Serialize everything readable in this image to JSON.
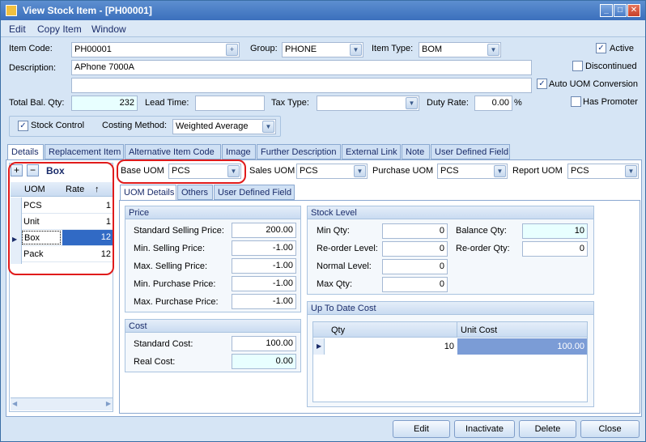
{
  "window": {
    "title": "View Stock Item - [PH00001]"
  },
  "menu": [
    "Edit",
    "Copy Item",
    "Window"
  ],
  "form": {
    "item_code_label": "Item Code:",
    "item_code": "PH00001",
    "group_label": "Group:",
    "group": "PHONE",
    "item_type_label": "Item Type:",
    "item_type": "BOM",
    "active_label": "Active",
    "discontinued_label": "Discontinued",
    "auto_uom_label": "Auto UOM Conversion",
    "has_promoter_label": "Has Promoter",
    "description_label": "Description:",
    "description": "APhone 7000A",
    "total_bal_label": "Total Bal. Qty:",
    "total_bal": "232",
    "lead_time_label": "Lead Time:",
    "tax_type_label": "Tax Type:",
    "duty_rate_label": "Duty Rate:",
    "duty_rate": "0.00",
    "percent": "%",
    "stock_control_label": "Stock Control",
    "costing_method_label": "Costing Method:",
    "costing_method": "Weighted Average"
  },
  "tabs": [
    "Details",
    "Replacement Item",
    "Alternative Item Code",
    "Image",
    "Further Description",
    "External Link",
    "Note",
    "User Defined Field"
  ],
  "uom_list": {
    "selected": "Box",
    "header": {
      "uom": "UOM",
      "rate": "Rate",
      "sort": "↑"
    },
    "rows": [
      {
        "uom": "PCS",
        "rate": "1"
      },
      {
        "uom": "Unit",
        "rate": "1"
      },
      {
        "uom": "Box",
        "rate": "12"
      },
      {
        "uom": "Pack",
        "rate": "12"
      }
    ]
  },
  "uom_bar": {
    "base_label": "Base UOM",
    "base": "PCS",
    "sales_label": "Sales UOM",
    "sales": "PCS",
    "purchase_label": "Purchase UOM",
    "purchase": "PCS",
    "report_label": "Report UOM",
    "report": "PCS"
  },
  "subtabs": [
    "UOM Details",
    "Others",
    "User Defined Field"
  ],
  "price": {
    "title": "Price",
    "std_sell_label": "Standard Selling Price:",
    "std_sell": "200.00",
    "min_sell_label": "Min. Selling Price:",
    "min_sell": "-1.00",
    "max_sell_label": "Max. Selling Price:",
    "max_sell": "-1.00",
    "min_pur_label": "Min. Purchase Price:",
    "min_pur": "-1.00",
    "max_pur_label": "Max. Purchase Price:",
    "max_pur": "-1.00"
  },
  "cost": {
    "title": "Cost",
    "std_cost_label": "Standard Cost:",
    "std_cost": "100.00",
    "real_cost_label": "Real Cost:",
    "real_cost": "0.00"
  },
  "stock_level": {
    "title": "Stock Level",
    "min_qty_label": "Min Qty:",
    "min_qty": "0",
    "reorder_level_label": "Re-order Level:",
    "reorder_level": "0",
    "normal_level_label": "Normal Level:",
    "normal_level": "0",
    "max_qty_label": "Max Qty:",
    "max_qty": "0",
    "bal_qty_label": "Balance Qty:",
    "bal_qty": "10",
    "reorder_qty_label": "Re-order Qty:",
    "reorder_qty": "0"
  },
  "up_to_date": {
    "title": "Up To Date Cost",
    "col_qty": "Qty",
    "col_unit_cost": "Unit Cost",
    "row_qty": "10",
    "row_unit_cost": "100.00"
  },
  "buttons": {
    "edit": "Edit",
    "inactivate": "Inactivate",
    "delete": "Delete",
    "close": "Close"
  }
}
